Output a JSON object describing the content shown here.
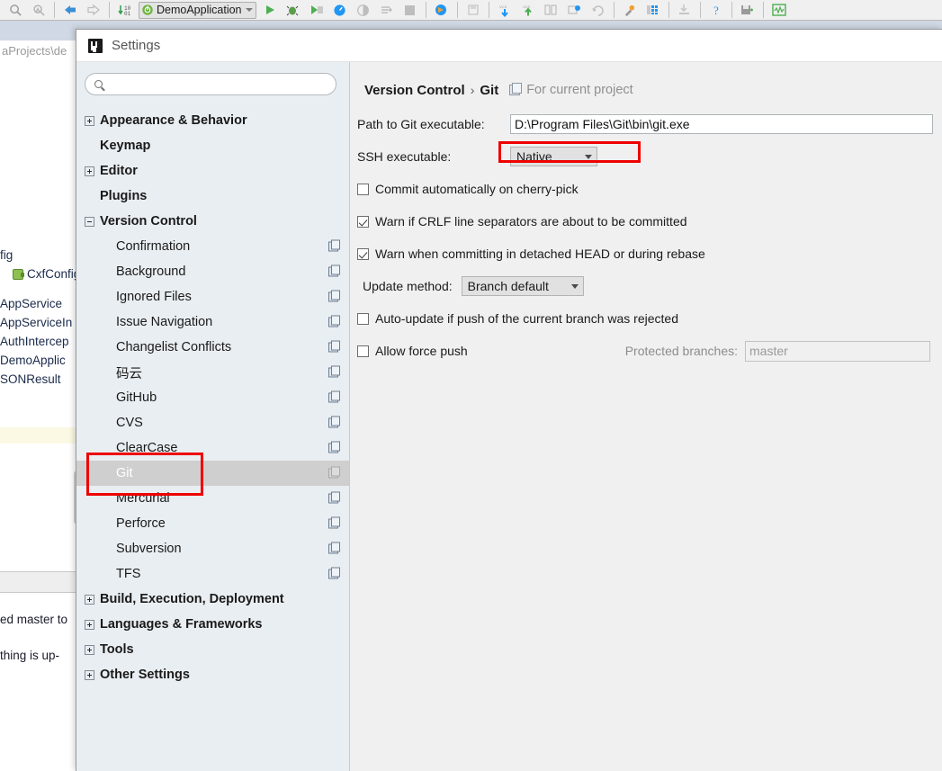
{
  "ide": {
    "toolbar": {
      "run_config_label": "DemoApplication",
      "icons": [
        "search-everywhere-icon",
        "structure-search-icon",
        "back-icon",
        "forward-icon",
        "toggle-line-numbers-icon",
        "run-icon",
        "debug-icon",
        "run-coverage-icon",
        "profiler-icon",
        "attach-debug-icon",
        "step-over-icon",
        "stop-icon",
        "browse-icon",
        "save-all-icon",
        "update-project-icon",
        "commit-icon",
        "diff-icon",
        "rollback-icon",
        "undo-icon",
        "settings-icon",
        "project-structure-icon",
        "import-icon",
        "help-icon",
        "save-icon",
        "monitor-icon"
      ]
    },
    "breadcrumb_text": "aProjects\\de",
    "project_tree": [
      {
        "label": "fig",
        "icon": ""
      },
      {
        "label": "CxfConfig",
        "icon": "bean-icon"
      }
    ],
    "editor_items": [
      "AppService",
      "AppServiceIn",
      "AuthIntercep",
      "DemoApplic",
      "SONResult"
    ],
    "console_lines": [
      "ed master to",
      "thing is up-"
    ]
  },
  "dialog": {
    "title": "Settings",
    "search": {
      "value": "",
      "placeholder": ""
    },
    "tree": [
      {
        "label": "Appearance & Behavior",
        "level": "top",
        "twisty": "plus",
        "badge": false,
        "selected": false
      },
      {
        "label": "Keymap",
        "level": "top",
        "twisty": "none",
        "badge": false,
        "selected": false
      },
      {
        "label": "Editor",
        "level": "top",
        "twisty": "plus",
        "badge": false,
        "selected": false
      },
      {
        "label": "Plugins",
        "level": "top",
        "twisty": "none",
        "badge": false,
        "selected": false
      },
      {
        "label": "Version Control",
        "level": "top",
        "twisty": "minus",
        "badge": false,
        "selected": false
      },
      {
        "label": "Confirmation",
        "level": "child",
        "twisty": "none",
        "badge": true,
        "selected": false
      },
      {
        "label": "Background",
        "level": "child",
        "twisty": "none",
        "badge": true,
        "selected": false
      },
      {
        "label": "Ignored Files",
        "level": "child",
        "twisty": "none",
        "badge": true,
        "selected": false
      },
      {
        "label": "Issue Navigation",
        "level": "child",
        "twisty": "none",
        "badge": true,
        "selected": false
      },
      {
        "label": "Changelist Conflicts",
        "level": "child",
        "twisty": "none",
        "badge": true,
        "selected": false
      },
      {
        "label": "码云",
        "level": "child",
        "twisty": "none",
        "badge": true,
        "selected": false
      },
      {
        "label": "GitHub",
        "level": "child",
        "twisty": "none",
        "badge": true,
        "selected": false
      },
      {
        "label": "CVS",
        "level": "child",
        "twisty": "none",
        "badge": true,
        "selected": false
      },
      {
        "label": "ClearCase",
        "level": "child",
        "twisty": "none",
        "badge": true,
        "selected": false
      },
      {
        "label": "Git",
        "level": "child",
        "twisty": "none",
        "badge": true,
        "selected": true
      },
      {
        "label": "Mercurial",
        "level": "child",
        "twisty": "none",
        "badge": true,
        "selected": false
      },
      {
        "label": "Perforce",
        "level": "child",
        "twisty": "none",
        "badge": true,
        "selected": false
      },
      {
        "label": "Subversion",
        "level": "child",
        "twisty": "none",
        "badge": true,
        "selected": false
      },
      {
        "label": "TFS",
        "level": "child",
        "twisty": "none",
        "badge": true,
        "selected": false
      },
      {
        "label": "Build, Execution, Deployment",
        "level": "top",
        "twisty": "plus",
        "badge": false,
        "selected": false
      },
      {
        "label": "Languages & Frameworks",
        "level": "top",
        "twisty": "plus",
        "badge": false,
        "selected": false
      },
      {
        "label": "Tools",
        "level": "top",
        "twisty": "plus",
        "badge": false,
        "selected": false
      },
      {
        "label": "Other Settings",
        "level": "top",
        "twisty": "plus",
        "badge": false,
        "selected": false
      }
    ],
    "page": {
      "breadcrumb_parent": "Version Control",
      "breadcrumb_sep": "›",
      "breadcrumb_current": "Git",
      "scope_label": "For current project",
      "path_label": "Path to Git executable:",
      "path_value": "D:\\Program Files\\Git\\bin\\git.exe",
      "ssh_label": "SSH executable:",
      "ssh_value": "Native",
      "cb_cherry_pick": "Commit automatically on cherry-pick",
      "cb_crlf": "Warn if CRLF line separators are about to be committed",
      "cb_detached": "Warn when committing in detached HEAD or during rebase",
      "update_method_label": "Update method:",
      "update_method_value": "Branch default",
      "cb_autoupdate": "Auto-update if push of the current branch was rejected",
      "cb_force_push": "Allow force push",
      "protected_label": "Protected branches:",
      "protected_value": "master"
    }
  },
  "annotation_color": "#ee0000"
}
